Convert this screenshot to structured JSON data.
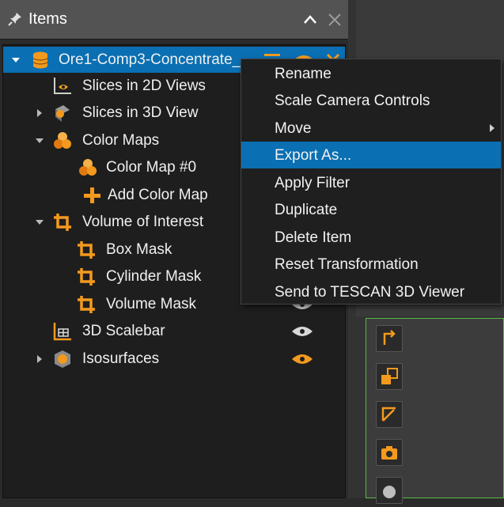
{
  "panel": {
    "title": "Items"
  },
  "tree": {
    "root_label": "Ore1-Comp3-Concentrate_",
    "items": [
      {
        "label": "Slices in 2D Views"
      },
      {
        "label": "Slices in 3D View"
      },
      {
        "label": "Color Maps"
      },
      {
        "label": "Color Map #0"
      },
      {
        "label": "Add Color Map"
      },
      {
        "label": "Volume of Interest"
      },
      {
        "label": "Box Mask"
      },
      {
        "label": "Cylinder Mask"
      },
      {
        "label": "Volume Mask"
      },
      {
        "label": "3D Scalebar"
      },
      {
        "label": "Isosurfaces"
      }
    ]
  },
  "context_menu": {
    "items": [
      {
        "label": "Rename"
      },
      {
        "label": "Scale Camera Controls"
      },
      {
        "label": "Move"
      },
      {
        "label": "Export As..."
      },
      {
        "label": "Apply Filter"
      },
      {
        "label": "Duplicate"
      },
      {
        "label": "Delete Item"
      },
      {
        "label": "Reset Transformation"
      },
      {
        "label": "Send to TESCAN 3D Viewer"
      }
    ],
    "highlighted": "Export As..."
  },
  "colors": {
    "accent_orange": "#f39a1e",
    "selection_blue": "#0a6fb3",
    "panel_border_green": "#5db84b"
  },
  "icons": [
    "pin-icon",
    "collapse-icon",
    "close-icon",
    "eye-icon",
    "volume-icon",
    "slices-2d-icon",
    "slices-3d-icon",
    "color-maps-icon",
    "color-map-icon",
    "plus-icon",
    "crop-icon",
    "scalebar-icon",
    "isosurface-icon"
  ]
}
